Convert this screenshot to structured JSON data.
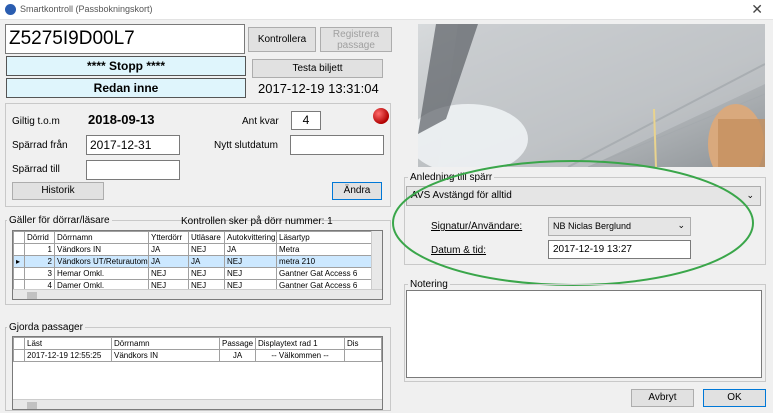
{
  "window": {
    "title": "Smartkontroll  (Passbokningskort)"
  },
  "card": {
    "id_value": "Z5275I9D00L7",
    "kontrollera_label": "Kontrollera",
    "registrera_label": "Registrera passage",
    "testa_label": "Testa biljett",
    "status_stopp": "**** Stopp ****",
    "status_inne": "Redan inne",
    "datetime": "2017-12-19 13:31:04"
  },
  "validity": {
    "giltig_label": "Giltig t.o.m",
    "giltig_value": "2018-09-13",
    "antkvar_label": "Ant kvar",
    "antkvar_value": "4",
    "sparrad_fran_label": "Spärrad från",
    "sparrad_fran_value": "2017-12-31",
    "nytt_slut_label": "Nytt slutdatum",
    "sparrad_till_label": "Spärrad till",
    "historik_label": "Historik",
    "andra_label": "Ändra"
  },
  "doors": {
    "title": "Gäller för dörrar/läsare",
    "kontroll_text": "Kontrollen sker på dörr nummer: 1",
    "columns": [
      "Dörrid",
      "Dörrnamn",
      "Ytterdörr",
      "Utläsare",
      "Autokvittering",
      "Läsartyp"
    ],
    "rows": [
      [
        "1",
        "Vändkors IN",
        "JA",
        "NEJ",
        "JA",
        "Metra"
      ],
      [
        "2",
        "Vändkors UT/Returautom",
        "JA",
        "JA",
        "NEJ",
        "metra 210"
      ],
      [
        "3",
        "Hemar Omkl.",
        "NEJ",
        "NEJ",
        "NEJ",
        "Gantner Gat Access 6"
      ],
      [
        "4",
        "Damer Omkl.",
        "NEJ",
        "NEJ",
        "NEJ",
        "Gantner Gat Access 6"
      ]
    ]
  },
  "passages": {
    "title": "Gjorda passager",
    "columns": [
      "Läst",
      "Dörrnamn",
      "Passage",
      "Displaytext rad 1",
      "Dis"
    ],
    "rows": [
      [
        "2017-12-19 12:55:25",
        "Vändkors IN",
        "JA",
        "-- Välkommen --",
        ""
      ]
    ]
  },
  "reason": {
    "title": "Anledning till spärr",
    "selected": "AVS Avstängd för alltid",
    "signatur_label": "Signatur/Användare:",
    "signatur_value": "NB Niclas Berglund",
    "datum_label": "Datum & tid:",
    "datum_value": "2017-12-19 13:27"
  },
  "notes": {
    "title": "Notering"
  },
  "footer": {
    "avbryt_label": "Avbryt",
    "ok_label": "OK"
  },
  "icons": {
    "status_dot": "red-status-dot"
  },
  "colors": {
    "status_bg": "#dff5fc",
    "selected_row": "#cce8ff",
    "annotation": "#3aa64a",
    "indicator": "#d40000"
  }
}
